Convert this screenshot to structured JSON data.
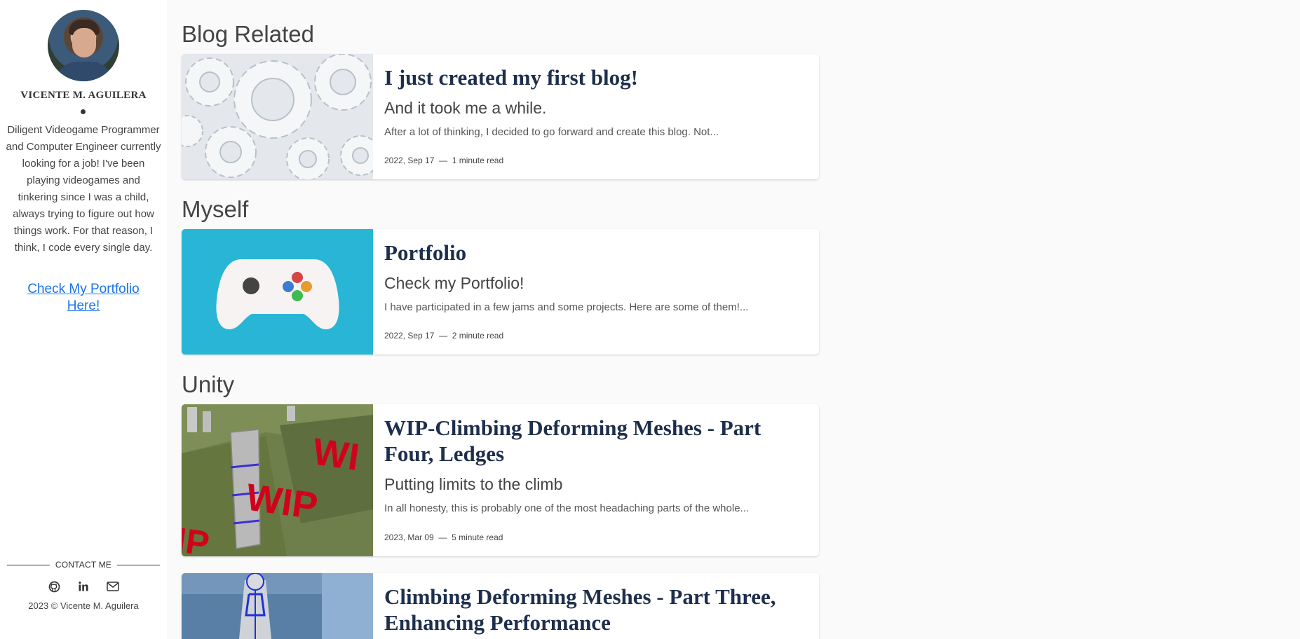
{
  "sidebar": {
    "name": "VICENTE M. AGUILERA",
    "bio": "Diligent Videogame Programmer and Computer Engineer currently looking for a job! I've been playing videogames and tinkering since I was a child, always trying to figure out how things work. For that reason, I think, I code every single day.",
    "portfolio_link": "Check My Portfolio Here!",
    "contact_label": "CONTACT ME",
    "socials": [
      "github-icon",
      "linkedin-icon",
      "email-icon"
    ],
    "copyright": "2023 © Vicente M. Aguilera"
  },
  "sections": [
    {
      "title": "Blog Related",
      "posts": [
        {
          "title": "I just created my first blog!",
          "subtitle": "And it took me a while.",
          "excerpt": "After a lot of thinking, I decided to go forward and create this blog. Not...",
          "date": "2022, Sep 17",
          "separator": "—",
          "read_time": "1 minute read"
        }
      ]
    },
    {
      "title": "Myself",
      "posts": [
        {
          "title": "Portfolio",
          "subtitle": "Check my Portfolio!",
          "excerpt": "I have participated in a few jams and some projects. Here are some of them!...",
          "date": "2022, Sep 17",
          "separator": "—",
          "read_time": "2 minute read"
        }
      ]
    },
    {
      "title": "Unity",
      "posts": [
        {
          "title": "WIP-Climbing Deforming Meshes - Part Four, Ledges",
          "subtitle": "Putting limits to the climb",
          "excerpt": "In all honesty, this is probably one of the most headaching parts of the whole...",
          "date": "2023, Mar 09",
          "separator": "—",
          "read_time": "5 minute read",
          "thumb_text": "WIP"
        },
        {
          "title": "Climbing Deforming Meshes - Part Three, Enhancing Performance"
        }
      ]
    }
  ],
  "colors": {
    "link": "#1a73e8",
    "card_title": "#1e2f4d",
    "portfolio_bg": "#29b6d6",
    "wip_red": "#d0021b"
  }
}
